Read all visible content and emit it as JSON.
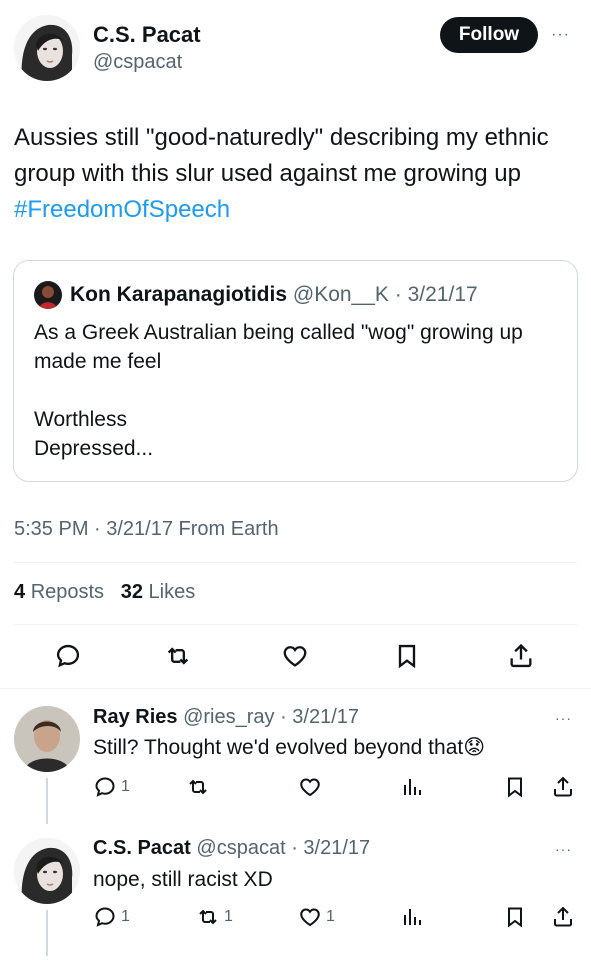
{
  "tweet": {
    "author_name": "C.S. Pacat",
    "author_handle": "@cspacat",
    "follow_label": "Follow",
    "more_label": "···",
    "text_before": "Aussies still \"good-naturedly\" describing my ethnic group with this slur used against me growing up ",
    "hashtag": "#FreedomOfSpeech",
    "timestamp": "5:35 PM · 3/21/17 From Earth",
    "reposts_count": "4",
    "reposts_label": "Reposts",
    "likes_count": "32",
    "likes_label": "Likes"
  },
  "quote": {
    "author_name": "Kon Karapanagiotidis",
    "author_handle": "@Kon__K",
    "date": "· 3/21/17",
    "body": "As a Greek Australian being called \"wog\" growing up made me feel\n\nWorthless\nDepressed..."
  },
  "replies": [
    {
      "author_name": "Ray Ries",
      "author_handle": "@ries_ray",
      "date": "· 3/21/17",
      "text": "Still? Thought we'd evolved beyond that",
      "emoji": "😟",
      "reply_count": "1",
      "repost_count": "",
      "like_count": ""
    },
    {
      "author_name": "C.S. Pacat",
      "author_handle": "@cspacat",
      "date": "· 3/21/17",
      "text": "nope, still racist XD",
      "reply_count": "1",
      "repost_count": "1",
      "like_count": "1"
    }
  ],
  "icons": {
    "reply": "reply-icon",
    "repost": "repost-icon",
    "like": "heart-icon",
    "bookmark": "bookmark-icon",
    "share": "share-icon",
    "views": "views-icon",
    "more": "more-icon"
  },
  "colors": {
    "accent": "#1d9bf0",
    "text": "#0f1419",
    "muted": "#536471",
    "border": "#cfd9de"
  }
}
